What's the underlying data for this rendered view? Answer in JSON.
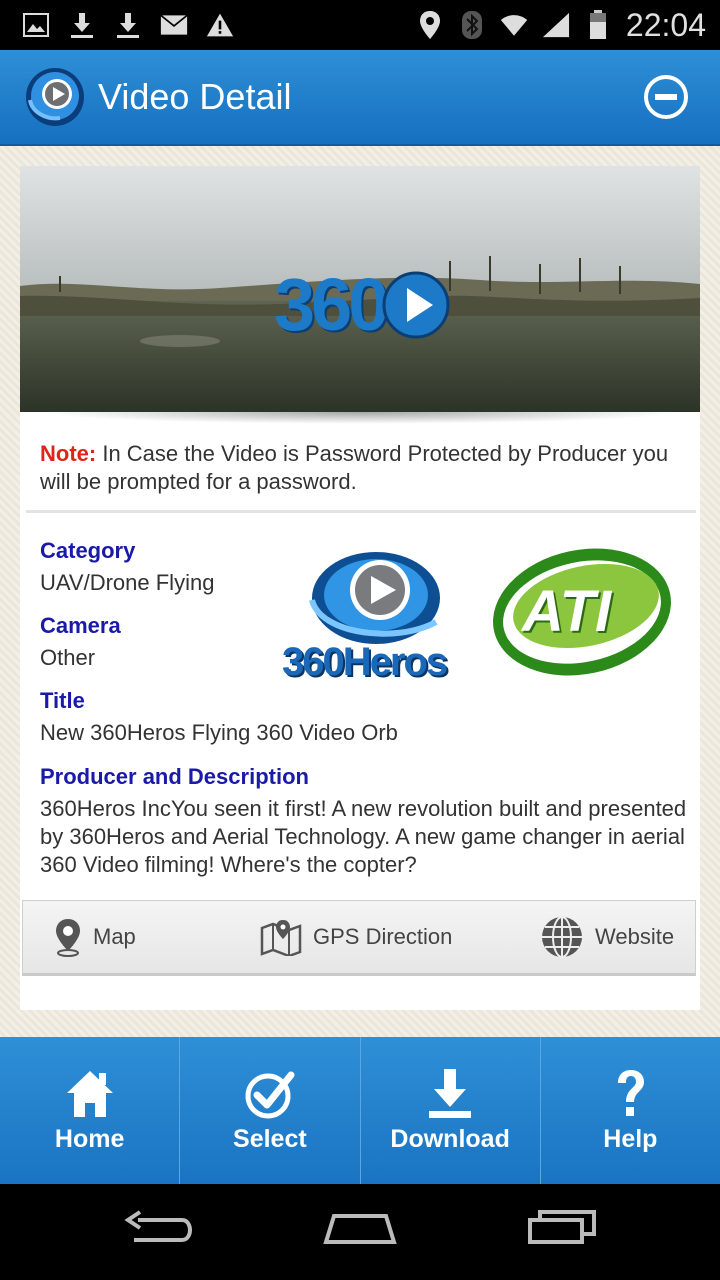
{
  "status_bar": {
    "time": "22:04",
    "icons": [
      "image-icon",
      "download-icon",
      "download-icon",
      "mail-icon",
      "warning-icon",
      "location-icon",
      "bluetooth-icon",
      "wifi-icon",
      "signal-icon",
      "battery-icon"
    ]
  },
  "header": {
    "title": "Video Detail",
    "logo_icon": "play-orb-icon",
    "close_icon": "minus-circle-icon"
  },
  "video": {
    "overlay_text": "360",
    "play_icon": "play-icon"
  },
  "note": {
    "label": "Note:",
    "text": " In Case the Video is Password Protected by Producer you will be prompted for a password."
  },
  "details": {
    "category_label": "Category",
    "category_value": "UAV/Drone Flying",
    "camera_label": "Camera",
    "camera_value": "Other",
    "title_label": "Title",
    "title_value": "New 360Heros Flying 360 Video Orb",
    "producer_label": "Producer and Description",
    "producer_value": "360Heros IncYou seen it first! A new revolution built and presented by 360Heros and Aerial Technology. A new game changer in aerial 360 Video filming! Where's the copter?"
  },
  "logos": {
    "left_text": "360Heros",
    "right_text": "ATI"
  },
  "actions": {
    "map": "Map",
    "gps": "GPS Direction",
    "website": "Website"
  },
  "bottom_nav": [
    {
      "label": "Home",
      "icon": "home-icon"
    },
    {
      "label": "Select",
      "icon": "check-circle-icon"
    },
    {
      "label": "Download",
      "icon": "download-tray-icon"
    },
    {
      "label": "Help",
      "icon": "question-icon"
    }
  ],
  "colors": {
    "header_blue": "#1f7fcc",
    "note_red": "#e0241b",
    "label_blue": "#1a1aa8"
  }
}
